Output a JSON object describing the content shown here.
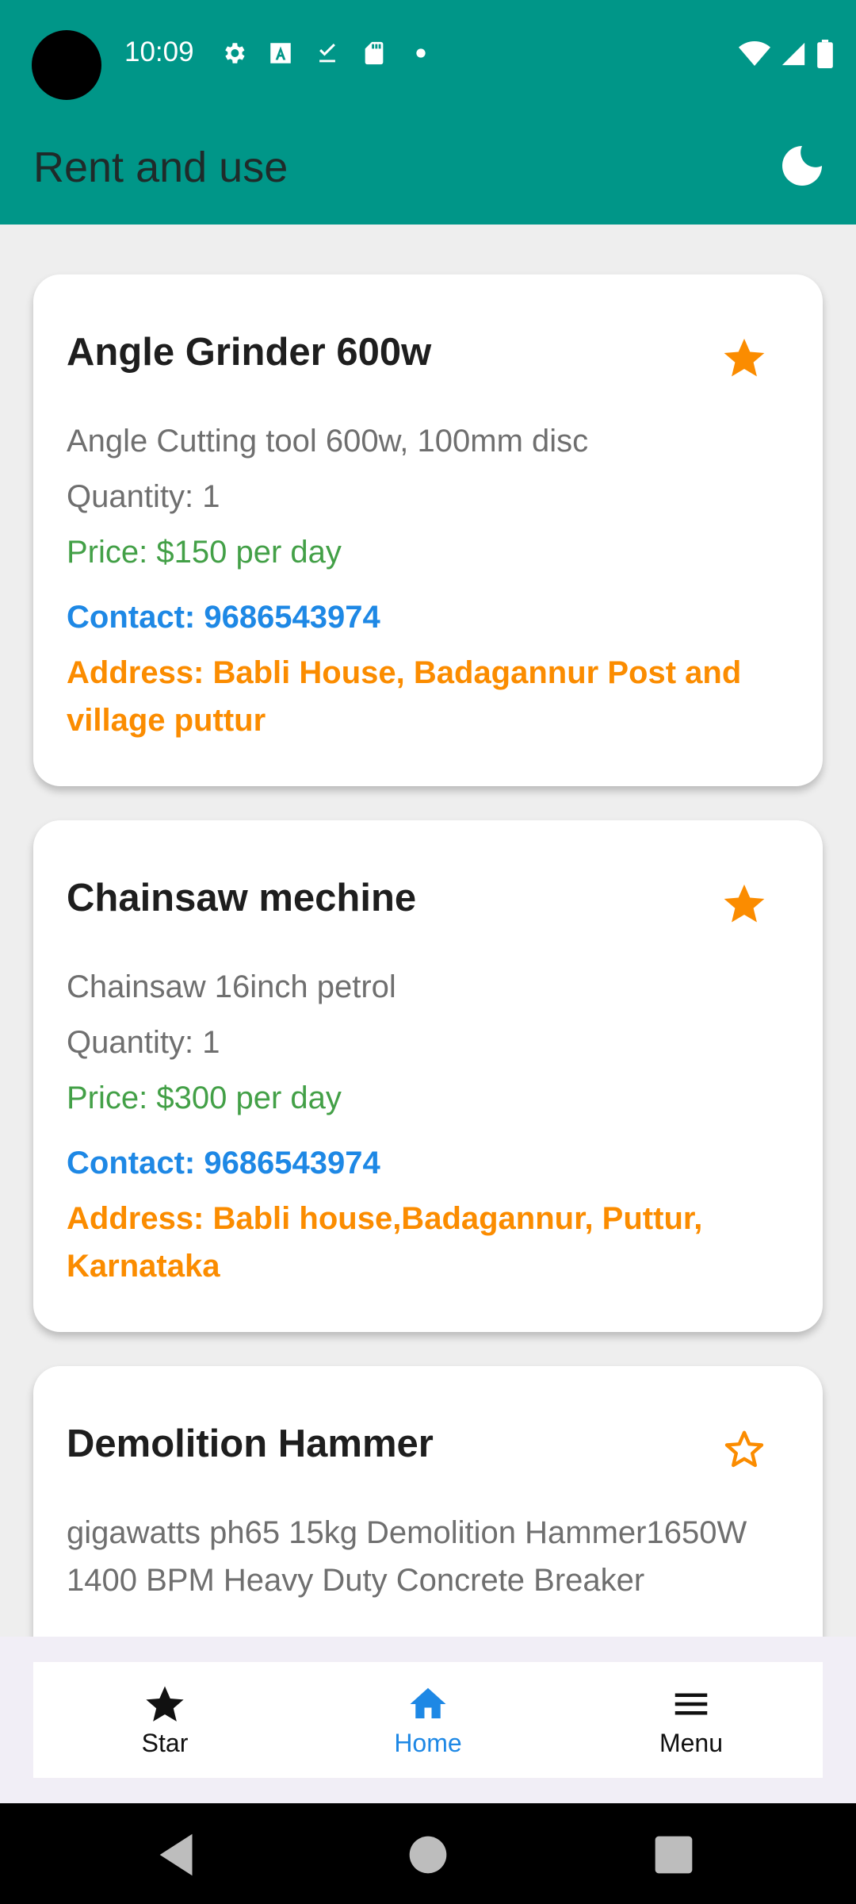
{
  "status_bar": {
    "time": "10:09",
    "icons": [
      "settings-icon",
      "text-a-icon",
      "download-done-icon",
      "sd-card-icon",
      "dot-icon",
      "wifi-icon",
      "signal-icon",
      "battery-icon"
    ]
  },
  "app_bar": {
    "title": "Rent and use",
    "theme_icon": "moon-icon"
  },
  "listings": [
    {
      "title": "Angle Grinder 600w",
      "description": "Angle Cutting tool 600w, 100mm disc",
      "quantity": "Quantity: 1",
      "price": "Price: $150 per day",
      "contact": "Contact: 9686543974",
      "address": "Address: Babli House, Badagannur Post and village puttur",
      "starred": true
    },
    {
      "title": "Chainsaw mechine",
      "description": "Chainsaw 16inch petrol",
      "quantity": "Quantity: 1",
      "price": "Price: $300 per day",
      "contact": "Contact: 9686543974",
      "address": "Address: Babli house,Badagannur, Puttur, Karnataka",
      "starred": true
    },
    {
      "title": "Demolition Hammer",
      "description": "gigawatts ph65 15kg Demolition Hammer1650W 1400 BPM Heavy Duty Concrete Breaker",
      "starred": false
    }
  ],
  "bottom_nav": {
    "items": [
      {
        "label": "Star",
        "icon": "star-icon",
        "active": false
      },
      {
        "label": "Home",
        "icon": "home-icon",
        "active": true
      },
      {
        "label": "Menu",
        "icon": "menu-icon",
        "active": false
      }
    ]
  },
  "colors": {
    "primary": "#009688",
    "star": "#fb8c00",
    "price": "#43a047",
    "contact": "#1e88e5",
    "address": "#fb8c00",
    "active_nav": "#1e88e5"
  }
}
